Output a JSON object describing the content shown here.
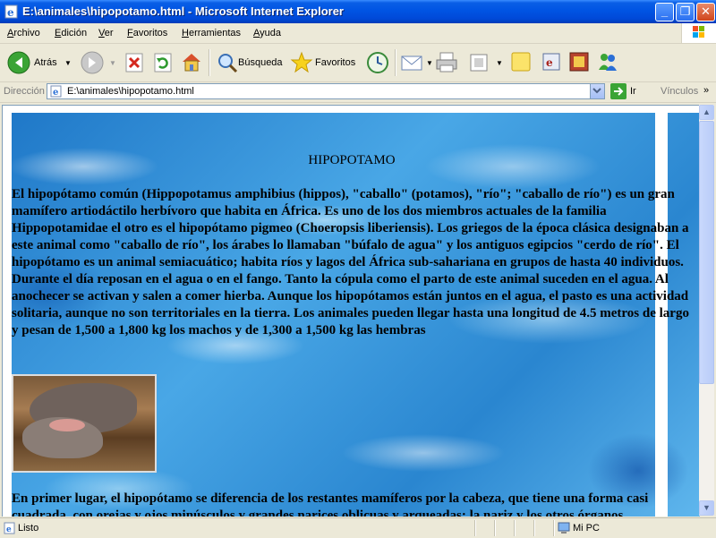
{
  "window": {
    "title": "E:\\animales\\hipopotamo.html - Microsoft Internet Explorer"
  },
  "menubar": {
    "items": [
      "Archivo",
      "Edición",
      "Ver",
      "Favoritos",
      "Herramientas",
      "Ayuda"
    ]
  },
  "toolbar": {
    "back_label": "Atrás",
    "search_label": "Búsqueda",
    "favorites_label": "Favoritos"
  },
  "addressbar": {
    "label": "Dirección",
    "value": "E:\\animales\\hipopotamo.html",
    "go_label": "Ir",
    "links_label": "Vínculos"
  },
  "page": {
    "heading": "HIPOPOTAMO",
    "paragraph1": "El hipopótamo común (Hippopotamus amphibius (hippos), \"caballo\" (potamos), \"río\"; \"caballo de río\") es un gran mamífero artiodáctilo herbívoro que habita en África. Es uno de los dos miembros actuales de la familia Hippopotamidae el otro es el hipopótamo pigmeo (Choeropsis liberiensis). Los griegos de la época clásica designaban a este animal como \"caballo de río\", los árabes lo llamaban \"búfalo de agua\" y los antiguos egipcios \"cerdo de río\". El hipopótamo es un animal semiacuático; habita ríos y lagos del África sub-sahariana en grupos de hasta 40 individuos. Durante el día reposan en el agua o en el fango. Tanto la cópula como el parto de este animal suceden en el agua. Al anochecer se activan y salen a comer hierba. Aunque los hipopótamos están juntos en el agua, el pasto es una actividad solitaria, aunque no son territoriales en la tierra. Los animales pueden llegar hasta una longitud de 4.5 metros de largo y pesan de 1,500 a 1,800 kg los machos y de 1,300 a 1,500 kg las hembras",
    "paragraph2": "En primer lugar, el hipopótamo se diferencia de los restantes mamíferos por la cabeza, que tiene una forma casi cuadrada, con orejas y ojos minúsculos y grandes narices oblicuas y arqueadas; la nariz y los otros órganos"
  },
  "statusbar": {
    "text": "Listo",
    "zone": "Mi PC"
  },
  "colors": {
    "titlebar": "#0054e3",
    "chrome": "#ece9d8",
    "water": "#2d8ad2"
  }
}
